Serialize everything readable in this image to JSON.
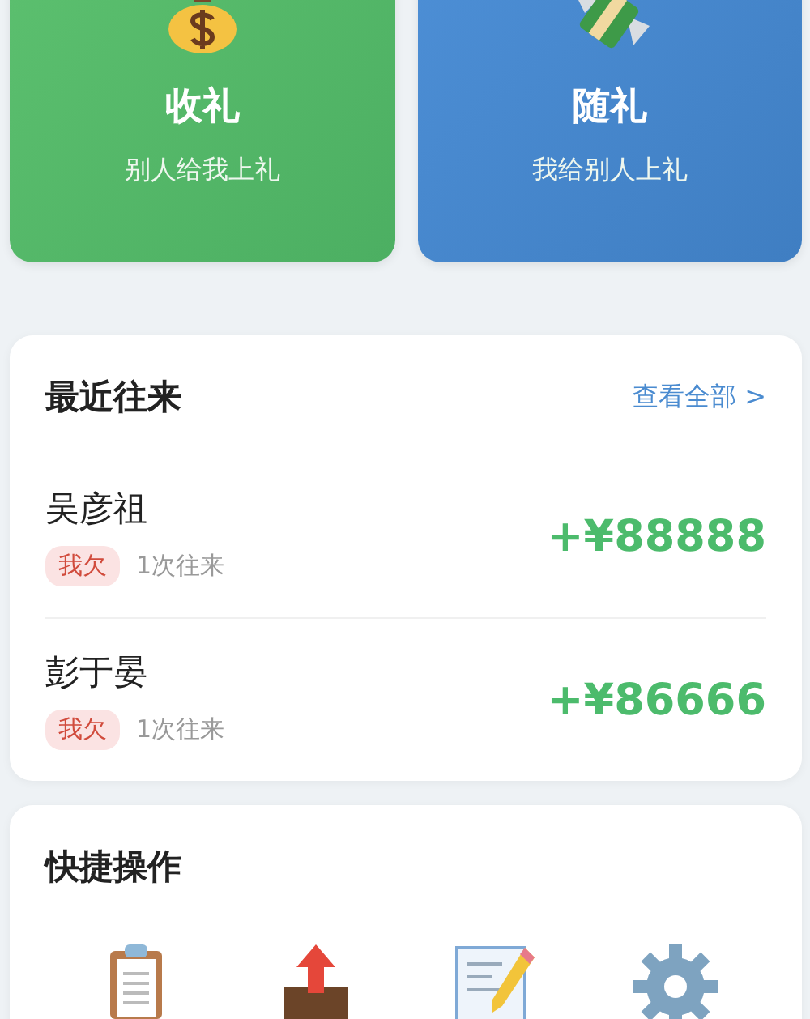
{
  "entry_cards": [
    {
      "kind": "receive",
      "title": "收礼",
      "subtitle": "别人给我上礼"
    },
    {
      "kind": "give",
      "title": "随礼",
      "subtitle": "我给别人上礼"
    }
  ],
  "recent": {
    "title": "最近往来",
    "view_all": "查看全部 >",
    "rows": [
      {
        "name": "吴彦祖",
        "tag": "我欠",
        "count": "1次往来",
        "amount": "+¥88888"
      },
      {
        "name": "彭于晏",
        "tag": "我欠",
        "count": "1次往来",
        "amount": "+¥86666"
      }
    ]
  },
  "quick_actions": {
    "title": "快捷操作",
    "items": [
      {
        "kind": "clipboard"
      },
      {
        "kind": "upload"
      },
      {
        "kind": "edit"
      },
      {
        "kind": "settings"
      }
    ]
  }
}
